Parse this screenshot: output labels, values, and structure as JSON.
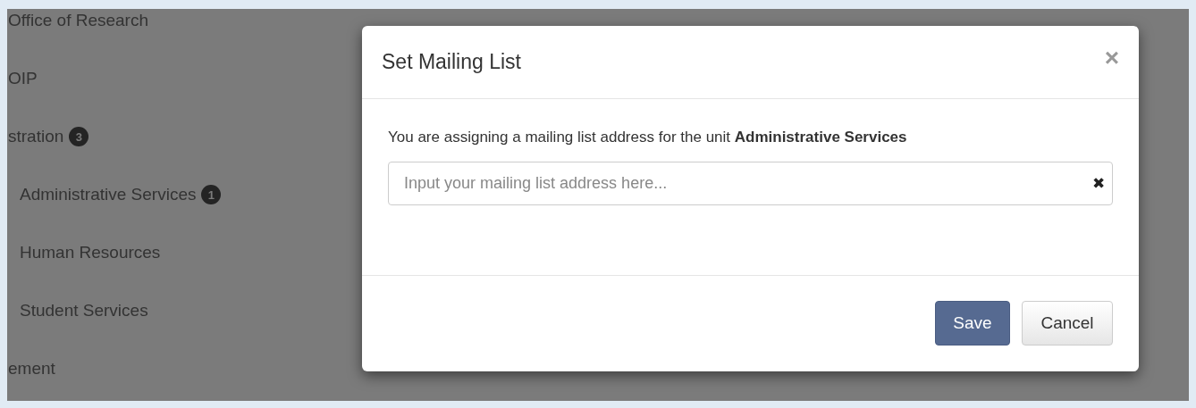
{
  "sidebar": {
    "items": [
      {
        "label": "Office of Research"
      },
      {
        "label": "OIP"
      },
      {
        "label": "stration",
        "badge": "3",
        "children": [
          {
            "label": "Administrative Services",
            "badge": "1"
          },
          {
            "label": "Human Resources"
          },
          {
            "label": "Student Services"
          }
        ]
      },
      {
        "label": "ement"
      }
    ]
  },
  "dialog": {
    "title": "Set Mailing List",
    "close": "×",
    "message": "You are assigning a mailing list address for the unit **Administrative Services**",
    "field": {
      "placeholder": "Input your mailing list address here...",
      "clear": "✖"
    },
    "buttons": [
      {
        "label": "Save",
        "kind": "primary"
      },
      {
        "label": "Cancel",
        "kind": "default"
      }
    ]
  }
}
